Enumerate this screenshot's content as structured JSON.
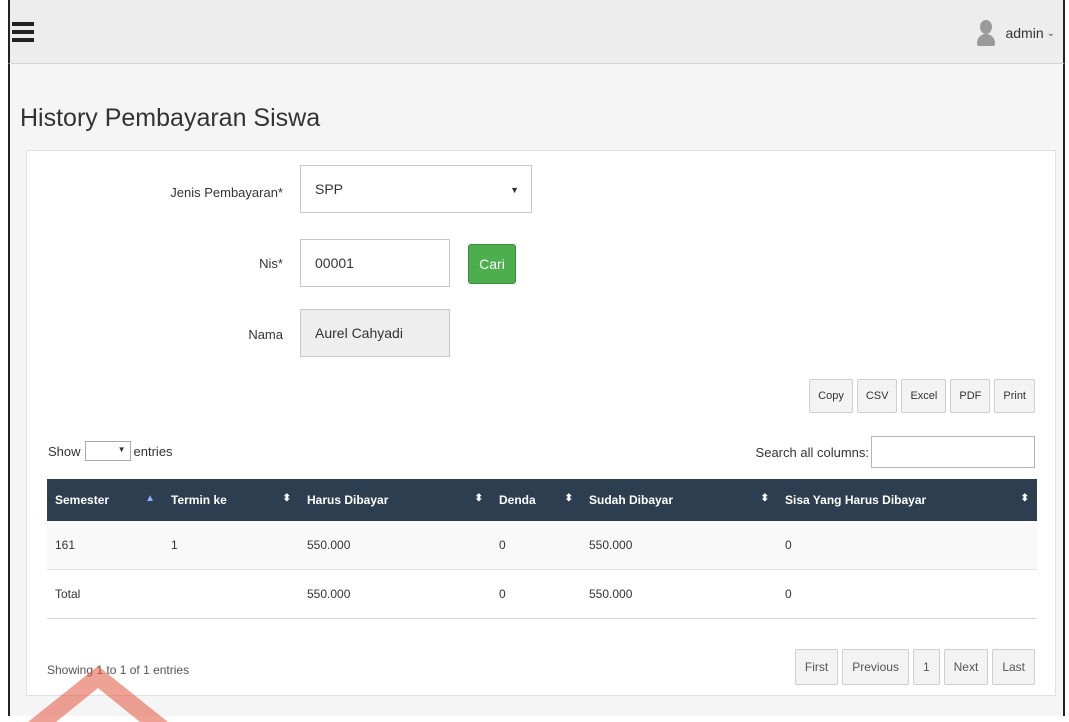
{
  "header": {
    "user_name": "admin"
  },
  "page_title": "History Pembayaran Siswa",
  "form": {
    "jenis_label": "Jenis Pembayaran*",
    "jenis_value": "SPP",
    "nis_label": "Nis*",
    "nis_value": "00001",
    "cari_label": "Cari",
    "nama_label": "Nama",
    "nama_value": "Aurel Cahyadi"
  },
  "export_buttons": [
    "Copy",
    "CSV",
    "Excel",
    "PDF",
    "Print"
  ],
  "table_controls": {
    "show_label": "Show",
    "entries_label": "entries",
    "search_label": "Search all columns:"
  },
  "table": {
    "columns": [
      "Semester",
      "Termin ke",
      "Harus Dibayar",
      "Denda",
      "Sudah Dibayar",
      "Sisa Yang Harus Dibayar"
    ],
    "rows": [
      [
        "161",
        "1",
        "550.000",
        "0",
        "550.000",
        "0"
      ],
      [
        "Total",
        "",
        "550.000",
        "0",
        "550.000",
        "0"
      ]
    ]
  },
  "info_text": "Showing 1 to 1 of 1 entries",
  "pagination": {
    "first": "First",
    "previous": "Previous",
    "page": "1",
    "next": "Next",
    "last": "Last"
  },
  "colors": {
    "header_bg": "#2c3e50",
    "cari_button": "#4cae4c",
    "watermark": "#e0533d"
  }
}
